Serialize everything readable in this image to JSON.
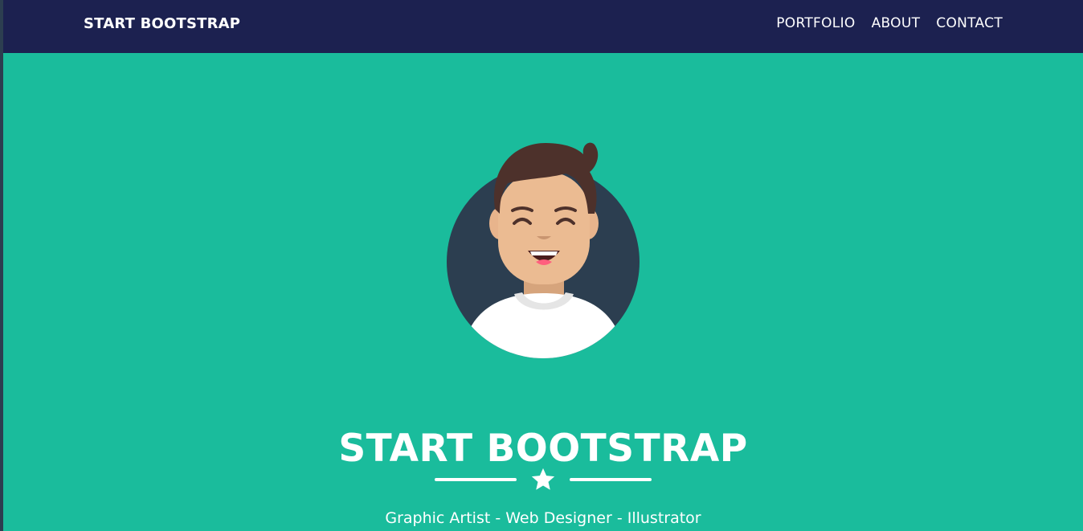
{
  "navbar": {
    "brand": "START BOOTSTRAP",
    "links": [
      "PORTFOLIO",
      "ABOUT",
      "CONTACT"
    ]
  },
  "masthead": {
    "avatar": "avatar-icon",
    "title": "START BOOTSTRAP",
    "divider_icon": "star-icon",
    "subtitle": "Graphic Artist - Web Designer - Illustrator"
  },
  "colors": {
    "navbar_bg": "#1c2150",
    "masthead_bg": "#1abc9c",
    "avatar_circle": "#2c3e50",
    "text": "#ffffff"
  }
}
